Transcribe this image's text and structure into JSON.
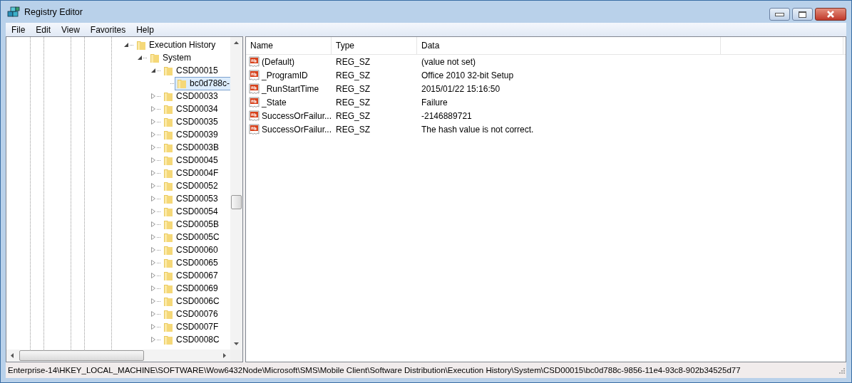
{
  "window": {
    "title": "Registry Editor"
  },
  "menu": [
    "File",
    "Edit",
    "View",
    "Favorites",
    "Help"
  ],
  "tree": [
    {
      "label": "Execution History",
      "expanded": true,
      "selected": false,
      "children": [
        {
          "label": "System",
          "expanded": true,
          "selected": false,
          "children": [
            {
              "label": "CSD00015",
              "expanded": true,
              "selected": false,
              "children": [
                {
                  "label": "bc0d788c-",
                  "selected": true
                }
              ]
            },
            {
              "label": "CSD00033",
              "expanded": false,
              "selected": false
            },
            {
              "label": "CSD00034",
              "expanded": false,
              "selected": false
            },
            {
              "label": "CSD00035",
              "expanded": false,
              "selected": false
            },
            {
              "label": "CSD00039",
              "expanded": false,
              "selected": false
            },
            {
              "label": "CSD0003B",
              "expanded": false,
              "selected": false
            },
            {
              "label": "CSD00045",
              "expanded": false,
              "selected": false
            },
            {
              "label": "CSD0004F",
              "expanded": false,
              "selected": false
            },
            {
              "label": "CSD00052",
              "expanded": false,
              "selected": false
            },
            {
              "label": "CSD00053",
              "expanded": false,
              "selected": false
            },
            {
              "label": "CSD00054",
              "expanded": false,
              "selected": false
            },
            {
              "label": "CSD0005B",
              "expanded": false,
              "selected": false
            },
            {
              "label": "CSD0005C",
              "expanded": false,
              "selected": false
            },
            {
              "label": "CSD00060",
              "expanded": false,
              "selected": false
            },
            {
              "label": "CSD00065",
              "expanded": false,
              "selected": false
            },
            {
              "label": "CSD00067",
              "expanded": false,
              "selected": false
            },
            {
              "label": "CSD00069",
              "expanded": false,
              "selected": false
            },
            {
              "label": "CSD0006C",
              "expanded": false,
              "selected": false
            },
            {
              "label": "CSD00076",
              "expanded": false,
              "selected": false
            },
            {
              "label": "CSD0007F",
              "expanded": false,
              "selected": false
            },
            {
              "label": "CSD0008C",
              "expanded": false,
              "selected": false
            }
          ]
        }
      ]
    }
  ],
  "table": {
    "columns": [
      "Name",
      "Type",
      "Data"
    ],
    "rows": [
      {
        "name": "(Default)",
        "type": "REG_SZ",
        "data": "(value not set)"
      },
      {
        "name": "_ProgramID",
        "type": "REG_SZ",
        "data": "Office 2010 32-bit Setup"
      },
      {
        "name": "_RunStartTime",
        "type": "REG_SZ",
        "data": "2015/01/22 15:16:50"
      },
      {
        "name": "_State",
        "type": "REG_SZ",
        "data": "Failure"
      },
      {
        "name": "SuccessOrFailur...",
        "type": "REG_SZ",
        "data": "-2146889721"
      },
      {
        "name": "SuccessOrFailur...",
        "type": "REG_SZ",
        "data": "The hash value is not correct."
      }
    ]
  },
  "status_bar": "Enterprise-14\\HKEY_LOCAL_MACHINE\\SOFTWARE\\Wow6432Node\\Microsoft\\SMS\\Mobile Client\\Software Distribution\\Execution History\\System\\CSD00015\\bc0d788c-9856-11e4-93c8-902b34525d77"
}
